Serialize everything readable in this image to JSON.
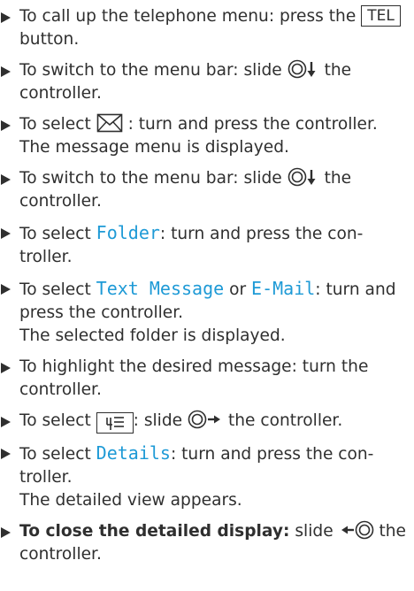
{
  "steps": [
    {
      "a": "To call up the telephone menu: press the",
      "key": "TEL",
      "b": "button."
    },
    {
      "a": "To switch to the menu bar: slide",
      "b": "the controller."
    },
    {
      "a": "To select",
      "b": ": turn and press the controller.",
      "result": "The message menu is displayed."
    },
    {
      "a": "To switch to the menu bar: slide",
      "b": "the controller."
    },
    {
      "a": "To select",
      "item": "Folder",
      "b": ": turn and press the con-troller."
    },
    {
      "a": "To select",
      "item1": "Text Message",
      "or": "or",
      "item2": "E-Mail",
      "b": ": turn and press the controller.",
      "result": "The selected folder is displayed."
    },
    {
      "a": "To highlight the desired message: turn the controller."
    },
    {
      "a": "To select",
      "b": ": slide",
      "c": "the controller."
    },
    {
      "a": "To select",
      "item": "Details",
      "b": ": turn and press the con-troller.",
      "result": "The detailed view appears."
    },
    {
      "bold": "To close the detailed display:",
      "a": "slide",
      "b": "the controller."
    }
  ],
  "icons": {
    "controller": "controller-icon",
    "down_arrow": "arrow-down-icon",
    "right_arrow": "arrow-right-icon",
    "left_arrow": "arrow-left-icon",
    "envelope": "envelope-icon",
    "menu_key": "menu-key-icon"
  },
  "colors": {
    "text": "#2f2f2f",
    "menu_item": "#1e9ad6"
  }
}
